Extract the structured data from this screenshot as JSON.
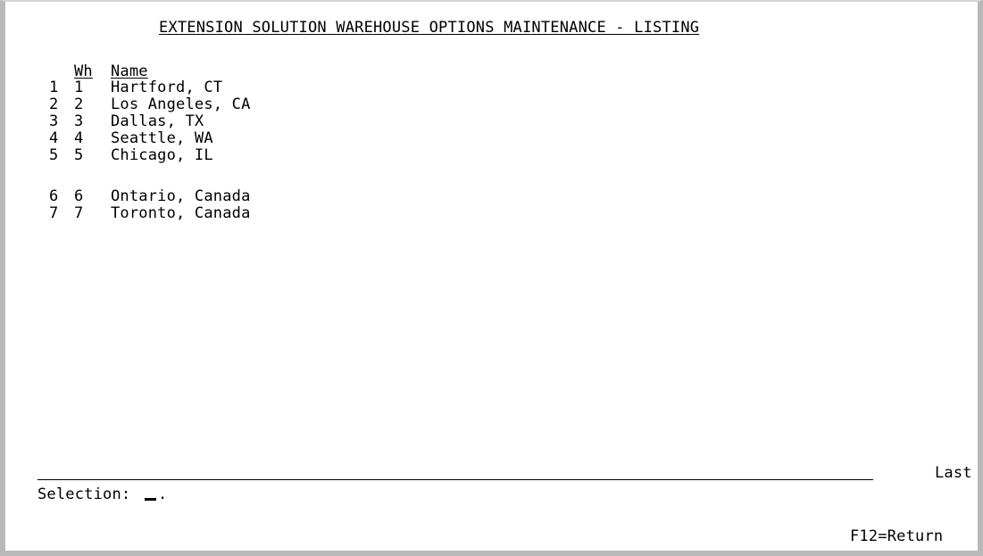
{
  "screen": {
    "title": "EXTENSION SOLUTION WAREHOUSE OPTIONS MAINTENANCE - LISTING"
  },
  "list": {
    "headers": {
      "wh": "Wh",
      "name": "Name"
    },
    "rows": [
      {
        "num": "1",
        "wh": "1",
        "name": "Hartford, CT"
      },
      {
        "num": "2",
        "wh": "2",
        "name": "Los Angeles, CA"
      },
      {
        "num": "3",
        "wh": "3",
        "name": "Dallas, TX"
      },
      {
        "num": "4",
        "wh": "4",
        "name": "Seattle, WA"
      },
      {
        "num": "5",
        "wh": "5",
        "name": "Chicago, IL"
      },
      {
        "num": "6",
        "wh": "6",
        "name": "Ontario, Canada"
      },
      {
        "num": "7",
        "wh": "7",
        "name": "Toronto, Canada"
      }
    ]
  },
  "footer": {
    "position_indicator": "Last",
    "selection_label": "Selection:",
    "selection_value": "",
    "selection_suffix": ".",
    "function_keys": "F12=Return"
  }
}
